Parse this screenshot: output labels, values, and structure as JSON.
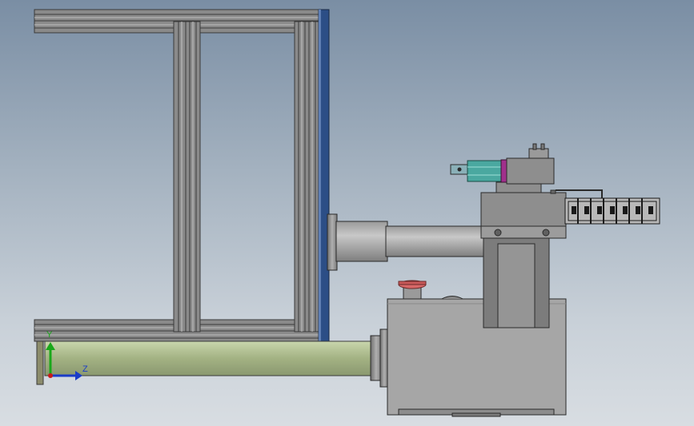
{
  "window": {
    "title": ""
  },
  "colors": {
    "background_top": "#7a8ea4",
    "background_bottom": "#d8dde2",
    "frame": "#8c8c8c",
    "panel": "#2c4e86",
    "housing": "#a8a8a8",
    "tube": "#b8c89c",
    "teal": "#4aa8a0",
    "magenta": "#a0308c",
    "button": "#d86868"
  },
  "triad": {
    "y_label": "Y",
    "z_label": "Z",
    "y_axis_icon": "arrow-up-green",
    "z_axis_icon": "arrow-right-blue"
  }
}
